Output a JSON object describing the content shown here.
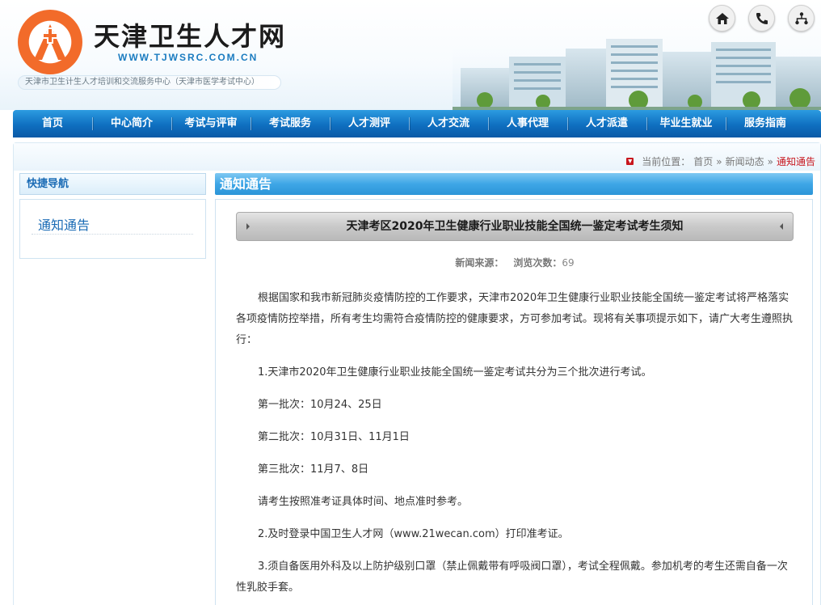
{
  "header": {
    "site_title": "天津卫生人才网",
    "site_url": "WWW.TJWSRC.COM.CN",
    "site_subtitle": "天津市卫生计生人才培训和交流服务中心（天津市医学考试中心）",
    "icons": [
      "home-icon",
      "phone-icon",
      "sitemap-icon"
    ],
    "brand_color": "#f26b2a"
  },
  "nav": {
    "items": [
      "首页",
      "中心简介",
      "考试与评审",
      "考试服务",
      "人才测评",
      "人才交流",
      "人事代理",
      "人才派遣",
      "毕业生就业",
      "服务指南"
    ],
    "color": "#0f6fc0"
  },
  "breadcrumb": {
    "label": "当前位置：",
    "items": [
      "首页",
      "新闻动态"
    ],
    "separator": "»",
    "current": "通知通告"
  },
  "sidebar": {
    "heading": "快捷导航",
    "link": "通知通告"
  },
  "main": {
    "heading": "通知通告",
    "article_title": "天津考区2020年卫生健康行业职业技能全国统一鉴定考试考生须知",
    "source_label": "新闻来源：",
    "views_label": "浏览次数：",
    "views": "69",
    "paragraphs": [
      "根据国家和我市新冠肺炎疫情防控的工作要求，天津市2020年卫生健康行业职业技能全国统一鉴定考试将严格落实各项疫情防控举措，所有考生均需符合疫情防控的健康要求，方可参加考试。现将有关事项提示如下，请广大考生遵照执行：",
      "1.天津市2020年卫生健康行业职业技能全国统一鉴定考试共分为三个批次进行考试。",
      "第一批次：10月24、25日",
      "第二批次：10月31日、11月1日",
      "第三批次：11月7、8日",
      "请考生按照准考证具体时间、地点准时参考。",
      "2.及时登录中国卫生人才网（www.21wecan.com）打印准考证。",
      "3.须自备医用外科及以上防护级别口罩（禁止佩戴带有呼吸阀口罩），考试全程佩戴。参加机考的考生还需自备一次性乳胶手套。"
    ]
  }
}
